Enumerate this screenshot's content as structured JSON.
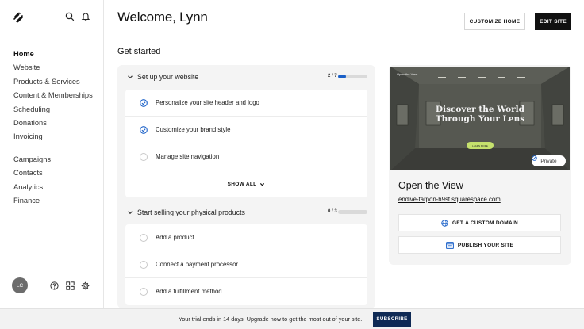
{
  "sidebar": {
    "logo_icon": "squarespace-logo",
    "top_icons": [
      "search-icon",
      "bell-icon"
    ],
    "nav_primary": [
      {
        "label": "Home",
        "active": true
      },
      {
        "label": "Website"
      },
      {
        "label": "Products & Services"
      },
      {
        "label": "Content & Memberships"
      },
      {
        "label": "Scheduling"
      },
      {
        "label": "Donations"
      },
      {
        "label": "Invoicing"
      }
    ],
    "nav_secondary": [
      {
        "label": "Campaigns"
      },
      {
        "label": "Contacts"
      },
      {
        "label": "Analytics"
      },
      {
        "label": "Finance"
      }
    ],
    "avatar_initials": "LC",
    "bottom_icons": [
      "help-icon",
      "apps-grid-icon",
      "settings-icon"
    ]
  },
  "header": {
    "welcome": "Welcome, Lynn",
    "customize_label": "CUSTOMIZE HOME",
    "edit_label": "EDIT SITE"
  },
  "get_started": {
    "title": "Get started",
    "groups": [
      {
        "title": "Set up your website",
        "count": "2 / 7",
        "progress": 0.28,
        "tasks": [
          {
            "label": "Personalize your site header and logo",
            "done": true
          },
          {
            "label": "Customize your brand style",
            "done": true
          },
          {
            "label": "Manage site navigation",
            "done": false
          }
        ],
        "show_all": "SHOW ALL"
      },
      {
        "title": "Start selling your physical products",
        "count": "0 / 3",
        "progress": 0,
        "tasks": [
          {
            "label": "Add a product",
            "done": false
          },
          {
            "label": "Connect a payment processor",
            "done": false
          },
          {
            "label": "Add a fulfillment method",
            "done": false
          }
        ]
      }
    ]
  },
  "site": {
    "preview": {
      "brand": "Open the View",
      "headline": "Discover the World Through Your Lens",
      "button": "LEARN MORE"
    },
    "private_label": "Private",
    "name": "Open the View",
    "url": "endive-tarpon-h9st.squarespace.com",
    "domain_button": "GET A CUSTOM DOMAIN",
    "publish_button": "PUBLISH YOUR SITE"
  },
  "trial": {
    "message": "Your trial ends in 14 days. Upgrade now to get the most out of your site.",
    "subscribe_label": "SUBSCRIBE"
  },
  "colors": {
    "accent": "#1a60c8",
    "subscribe": "#0f2a55",
    "preview_button": "#c5e16d"
  }
}
